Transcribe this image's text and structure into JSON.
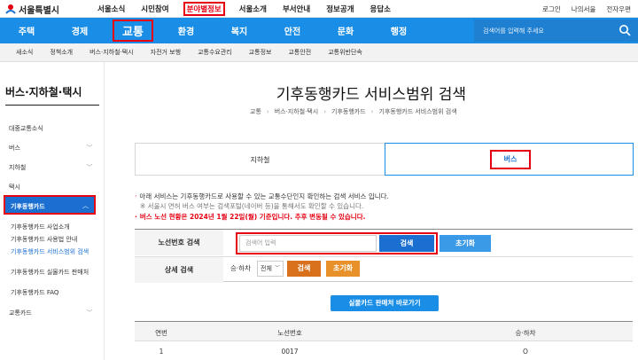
{
  "topbar": {
    "logo_text": "서울특별시",
    "nav": [
      "서울소식",
      "시민참여",
      "분야별정보",
      "서울소개",
      "부서안내",
      "정보공개",
      "응답소"
    ],
    "active_nav": "분야별정보",
    "right": [
      "로그인",
      "나의서울",
      "전자우편"
    ]
  },
  "mainnav": {
    "items": [
      "주택",
      "경제",
      "교통",
      "환경",
      "복지",
      "안전",
      "문화",
      "행정"
    ],
    "active": "교통",
    "search_placeholder": "검색어를 입력해 주세요"
  },
  "subnav": [
    "새소식",
    "정책소개",
    "버스·지하철·택시",
    "자전거 보행",
    "교통수요관리",
    "교통정보",
    "교통안전",
    "교통위반단속"
  ],
  "sidebar": {
    "title": "버스·지하철·택시",
    "items": [
      "대중교통소식",
      "버스",
      "지하철",
      "택시"
    ],
    "active": "기후동행카드",
    "subitems": [
      "기후동행카드 사업소개",
      "기후동행카드 사용법 안내",
      "기후동행카드 서비스범위 검색",
      "기후동행카드 실물카드 판매처",
      "기후동행카드 FAQ"
    ],
    "last_item": "교통카드"
  },
  "main": {
    "title": "기후동행카드 서비스범위 검색",
    "breadcrumb": [
      "교통",
      "버스·지하철·택시",
      "기후동행카드",
      "기후동행카드 서비스범위 검색"
    ],
    "tabs": [
      "지하철",
      "버스"
    ],
    "notice1": "아래 서비스는 기후동행카드로 사용할 수 있는 교통수단인지 확인하는 검색 서비스 입니다.",
    "notice2": "※ 서울시 면허 버스 여부는 검색포털(네이버 등)을 통해서도 확인할 수 있습니다.",
    "notice3": "버스 노선 현황은 2024년 1월 22일(월) 기준입니다. 추후 변동될 수 있습니다.",
    "form": {
      "route_label": "노선번호 검색",
      "route_placeholder": "검색어 입력",
      "search_button": "검색",
      "reset_button": "초기화",
      "detail_label_head": "상세 검색",
      "detail_label": "승·하차",
      "select_value": "전체"
    },
    "store_button": "실물카드 판매처 바로가기",
    "table": {
      "headers": [
        "연번",
        "노선번호",
        "승·하차"
      ],
      "rows": [
        [
          "1",
          "0017",
          "O"
        ]
      ]
    }
  },
  "colors": {
    "primary": "#1a8ee6",
    "highlight": "#e60012",
    "orange": "#d9711c"
  }
}
